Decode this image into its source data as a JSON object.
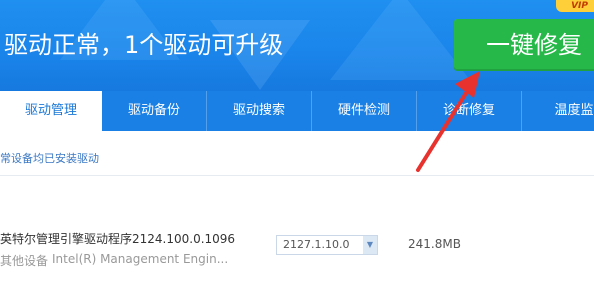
{
  "header": {
    "status_text": "驱动正常，1个驱动可升级",
    "vip_label": "VIP",
    "fix_button_label": "一键修复"
  },
  "tabs": [
    {
      "label": "驱动管理",
      "active": true
    },
    {
      "label": "驱动备份",
      "active": false
    },
    {
      "label": "驱动搜索",
      "active": false
    },
    {
      "label": "硬件检测",
      "active": false
    },
    {
      "label": "诊断修复",
      "active": false
    },
    {
      "label": "温度监",
      "active": false
    }
  ],
  "content": {
    "status_line": "常设备均已安装驱动",
    "driver": {
      "name": "英特尔管理引擎驱动程序2124.100.0.1096",
      "category": "其他设备",
      "description": "Intel(R) Management Engin...",
      "version_selected": "2127.1.10.0",
      "size": "241.8MB"
    }
  },
  "colors": {
    "header_blue": "#1f8ff0",
    "tab_blue": "#1a80e6",
    "fix_button_green": "#27b84a",
    "annotation_arrow": "#e8322e"
  }
}
